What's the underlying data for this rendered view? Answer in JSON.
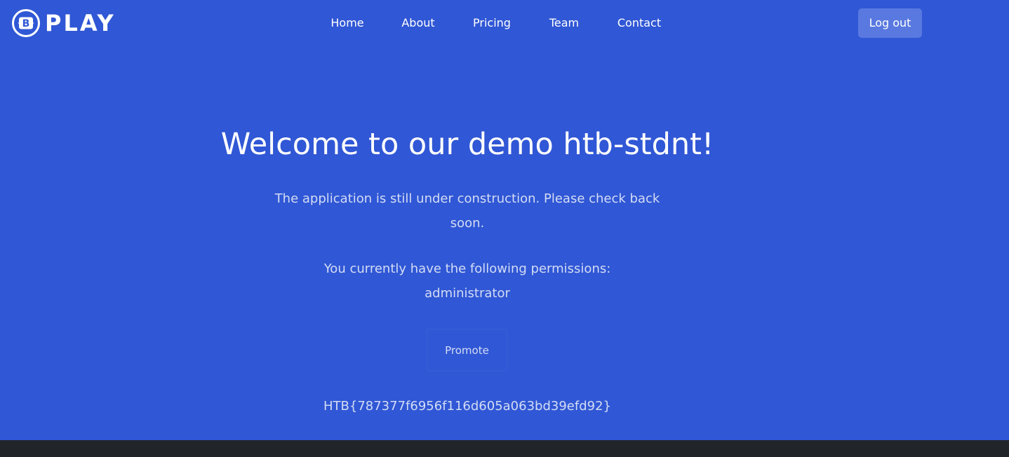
{
  "brand": {
    "name": "PLAY",
    "mark_letter": "B"
  },
  "nav": {
    "items": [
      {
        "label": "Home"
      },
      {
        "label": "About"
      },
      {
        "label": "Pricing"
      },
      {
        "label": "Team"
      },
      {
        "label": "Contact"
      }
    ],
    "logout_label": "Log out"
  },
  "main": {
    "title": "Welcome to our demo htb-stdnt!",
    "construction_text": "The application is still under construction. Please check back soon.",
    "permissions_label": "You currently have the following permissions:",
    "permission_value": "administrator",
    "promote_label": "Promote",
    "flag": "HTB{787377f6956f116d605a063bd39efd92}"
  },
  "colors": {
    "background": "#3057d5",
    "footer": "#212529",
    "logout_button": "#5979e0",
    "muted_text": "#d3dcf5"
  }
}
